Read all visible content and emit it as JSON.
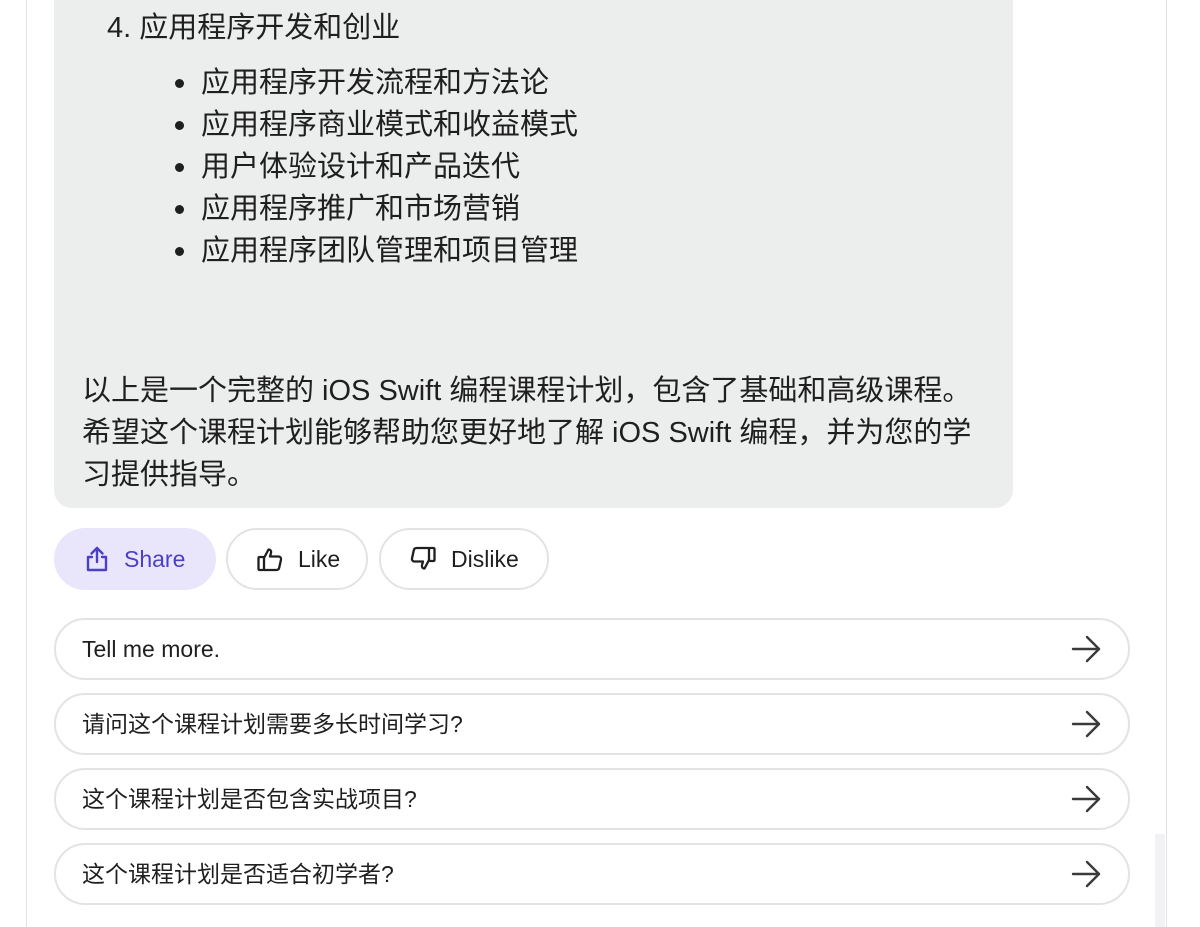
{
  "message": {
    "section_heading": "4. 应用程序开发和创业",
    "bullets": [
      "应用程序开发流程和方法论",
      "应用程序商业模式和收益模式",
      "用户体验设计和产品迭代",
      "应用程序推广和市场营销",
      "应用程序团队管理和项目管理"
    ],
    "summary": "以上是一个完整的 iOS Swift 编程课程计划，包含了基础和高级课程。希望这个课程计划能够帮助您更好地了解 iOS Swift 编程，并为您的学习提供指导。"
  },
  "actions": {
    "share_label": "Share",
    "like_label": "Like",
    "dislike_label": "Dislike"
  },
  "suggestions": [
    "Tell me more.",
    "请问这个课程计划需要多长时间学习?",
    "这个课程计划是否包含实战项目?",
    "这个课程计划是否适合初学者?"
  ],
  "icons": {
    "share": "share-icon",
    "like": "thumbs-up-icon",
    "dislike": "thumbs-down-icon",
    "suggestion_arrow": "arrow-right-icon"
  },
  "colors": {
    "bubble_bg": "#eceded",
    "share_bg": "#e9e6fb",
    "share_accent": "#4b3fc6",
    "border": "#e3e3e6",
    "text": "#1f1f1f"
  }
}
